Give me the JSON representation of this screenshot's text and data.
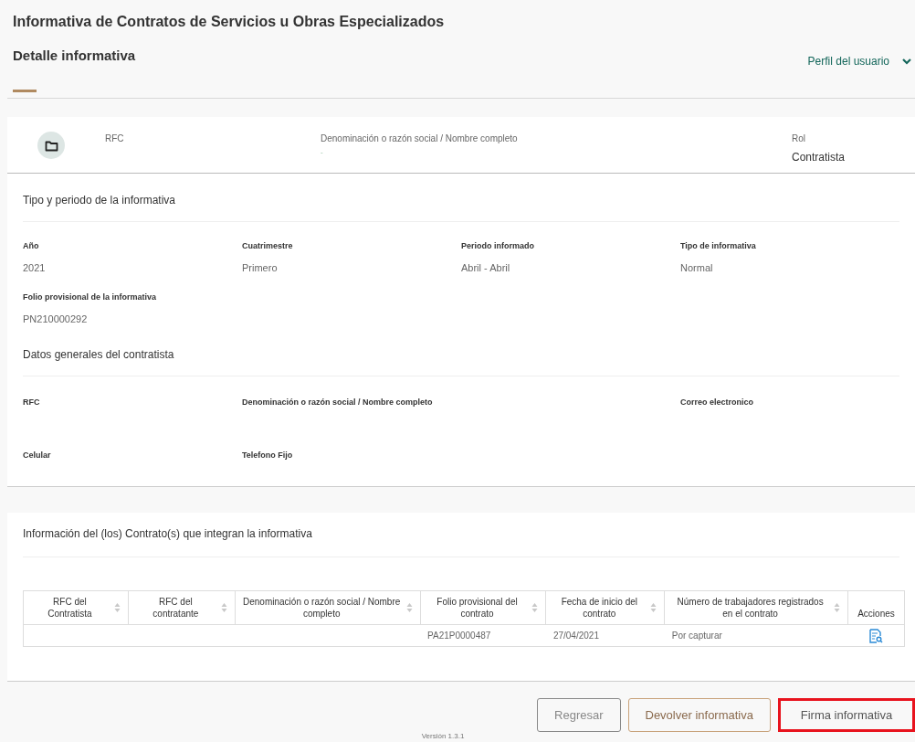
{
  "page": {
    "title": "Informativa de Contratos de Servicios u Obras Especializados",
    "subtitle": "Detalle informativa",
    "profile_menu": {
      "label": "Perfil del usuario",
      "expanded": false
    }
  },
  "user_bar": {
    "fields": [
      {
        "label": "RFC"
      },
      {
        "label": "Denominación o razón social / Nombre completo",
        "value": "-"
      },
      {
        "label": "Rol",
        "value": "Contratista"
      }
    ]
  },
  "section_period": {
    "title": "Tipo y periodo de la informativa",
    "fields": [
      {
        "label": "Año",
        "value": "2021"
      },
      {
        "label": "Cuatrimestre",
        "value": "Primero"
      },
      {
        "label": "Periodo informado",
        "value": "Abril - Abril"
      },
      {
        "label": "Tipo de informativa",
        "value": "Normal"
      },
      {
        "label": "Folio provisional de la informativa",
        "value": "PN210000292"
      }
    ]
  },
  "section_contractor": {
    "title": "Datos generales del contratista",
    "rows": [
      [
        {
          "label": "RFC"
        },
        {
          "label": "Denominación o razón social / Nombre completo"
        },
        null,
        {
          "label": "Correo electronico"
        }
      ],
      [
        {
          "label": "Celular"
        },
        {
          "label": "Telefono Fijo"
        },
        null,
        null
      ]
    ]
  },
  "section_contracts": {
    "title": "Información del (los) Contrato(s) que integran la informativa",
    "table": {
      "columns": [
        {
          "label": "RFC del Contratista",
          "sortable": true
        },
        {
          "label": "RFC del contratante",
          "sortable": true
        },
        {
          "label": "Denominación o razón social / Nombre completo",
          "sortable": true
        },
        {
          "label": "Folio provisional del contrato",
          "sortable": true
        },
        {
          "label": "Fecha de inicio del contrato",
          "sortable": true
        },
        {
          "label": "Número de trabajadores registrados en el contrato",
          "sortable": true
        },
        {
          "label": "Acciones",
          "sortable": false
        }
      ],
      "rows": [
        {
          "cells": [
            "",
            "",
            "",
            "PA21P0000487",
            "27/04/2021",
            "Por capturar"
          ]
        }
      ]
    }
  },
  "buttons": [
    {
      "label": "Regresar",
      "kind": "secondary",
      "highlighted": false
    },
    {
      "label": "Devolver informativa",
      "kind": "outline",
      "highlighted": false
    },
    {
      "label": "Firma informativa",
      "kind": "plain",
      "highlighted": true
    }
  ],
  "footer": {
    "version": "Versión 1.3.1"
  }
}
